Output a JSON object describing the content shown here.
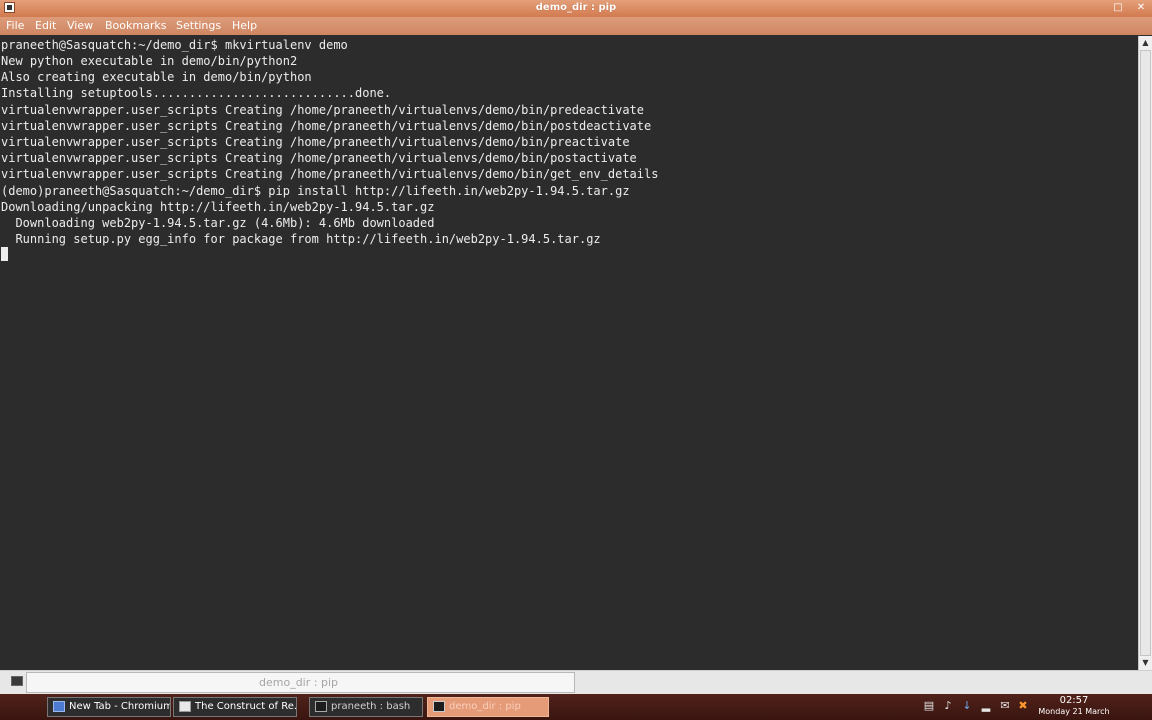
{
  "window": {
    "title": "demo_dir : pip"
  },
  "menu": [
    "File",
    "Edit",
    "View",
    "Bookmarks",
    "Settings",
    "Help"
  ],
  "terminal_lines": [
    "praneeth@Sasquatch:~/demo_dir$ mkvirtualenv demo",
    "New python executable in demo/bin/python2",
    "Also creating executable in demo/bin/python",
    "Installing setuptools............................done.",
    "virtualenvwrapper.user_scripts Creating /home/praneeth/virtualenvs/demo/bin/predeactivate",
    "virtualenvwrapper.user_scripts Creating /home/praneeth/virtualenvs/demo/bin/postdeactivate",
    "virtualenvwrapper.user_scripts Creating /home/praneeth/virtualenvs/demo/bin/preactivate",
    "virtualenvwrapper.user_scripts Creating /home/praneeth/virtualenvs/demo/bin/postactivate",
    "virtualenvwrapper.user_scripts Creating /home/praneeth/virtualenvs/demo/bin/get_env_details",
    "(demo)praneeth@Sasquatch:~/demo_dir$ pip install http://lifeeth.in/web2py-1.94.5.tar.gz",
    "Downloading/unpacking http://lifeeth.in/web2py-1.94.5.tar.gz",
    "  Downloading web2py-1.94.5.tar.gz (4.6Mb): 4.6Mb downloaded",
    "  Running setup.py egg_info for package from http://lifeeth.in/web2py-1.94.5.tar.gz"
  ],
  "session_tab": {
    "label": "demo_dir : pip"
  },
  "taskbar": {
    "tasks": [
      {
        "label": "New Tab - Chromium",
        "icon": "chromium-icon",
        "active": false
      },
      {
        "label": "The Construct of Re...",
        "icon": "document-icon",
        "active": false
      },
      {
        "label": "praneeth : bash",
        "icon": "terminal-icon",
        "active": false
      },
      {
        "label": "demo_dir : pip",
        "icon": "terminal-icon",
        "active": true
      }
    ],
    "tray": [
      "clipboard-icon",
      "volume-icon",
      "download-icon",
      "network-signal-icon",
      "chat-icon",
      "settings-x-icon"
    ],
    "clock": {
      "time": "02:57",
      "date": "Monday 21 March"
    }
  }
}
